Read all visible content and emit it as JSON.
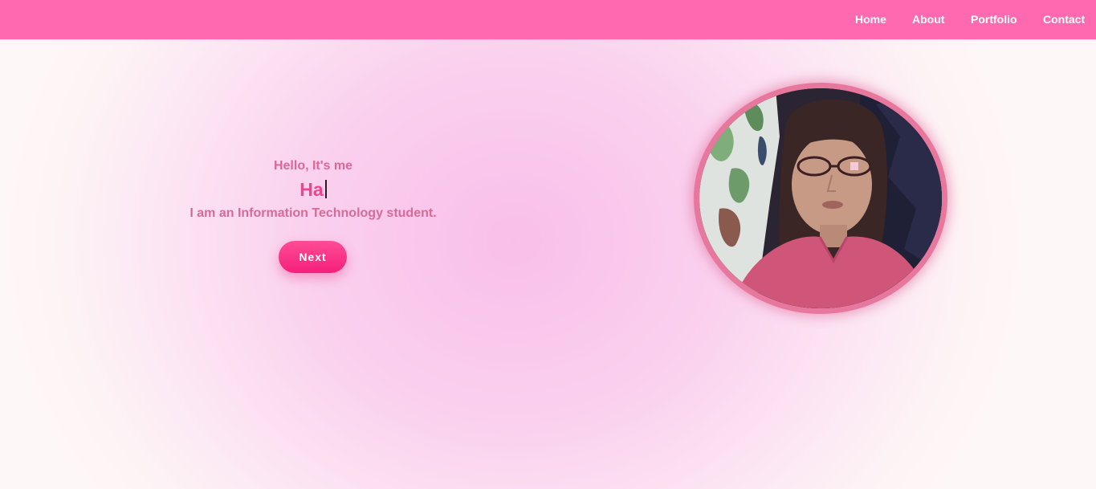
{
  "nav": {
    "items": [
      {
        "label": "Home"
      },
      {
        "label": "About"
      },
      {
        "label": "Portfolio"
      },
      {
        "label": "Contact"
      }
    ]
  },
  "hero": {
    "greeting": "Hello, It's me",
    "typed_name": "Ha",
    "tagline": "I am an Information Technology student.",
    "next_label": "Next"
  },
  "profile_photo": {
    "icon": "profile-photo"
  },
  "colors": {
    "navbar": "#ff69b0",
    "accent": "#f2448e",
    "text_pink": "#d96a98",
    "button": "#f51f7b"
  }
}
